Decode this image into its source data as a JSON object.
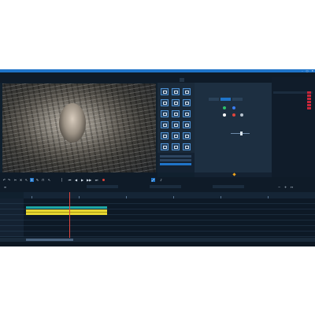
{
  "window": {
    "title": "",
    "controls": [
      "–",
      "□",
      "✕"
    ]
  },
  "menu": [],
  "preview": {
    "header": "",
    "timecode": ""
  },
  "tabs": [],
  "effects": {
    "header": "",
    "tiles": [],
    "selected_list": []
  },
  "settings": {
    "title": "",
    "modes": []
  },
  "explorer": {
    "header": "",
    "items": []
  },
  "timeline": {
    "tracks": [],
    "ruler": []
  },
  "colors": {
    "accent": "#1f74c9",
    "video_clip": "#1fa7a3",
    "audio_clip": "#e6d631",
    "playhead": "#e0443c"
  }
}
